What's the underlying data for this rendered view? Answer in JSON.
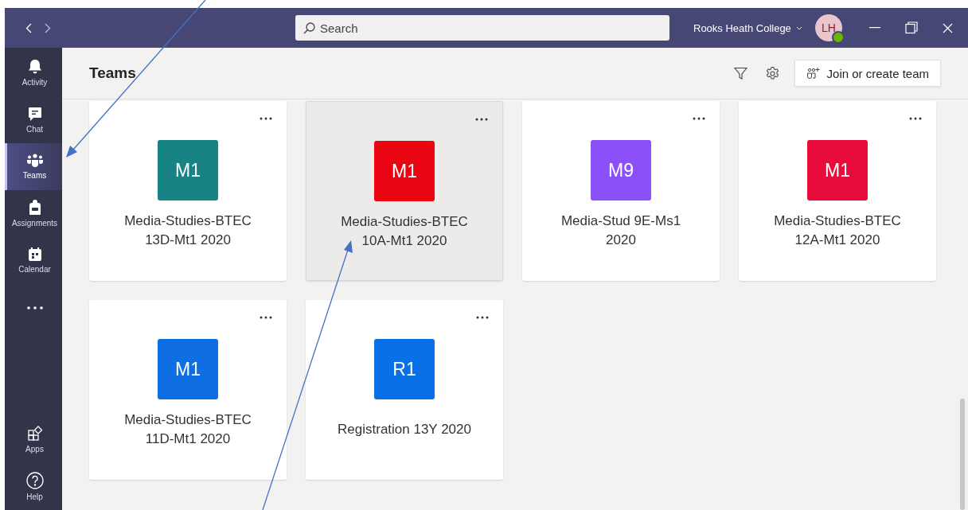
{
  "title_bar": {
    "search_placeholder": "Search",
    "organization": "Rooks Heath College",
    "avatar_initials": "LH",
    "presence_available": true
  },
  "rail": {
    "items": [
      {
        "kind": "activity",
        "label": "Activity",
        "selected": false
      },
      {
        "kind": "chat",
        "label": "Chat",
        "selected": false
      },
      {
        "kind": "teams",
        "label": "Teams",
        "selected": true
      },
      {
        "kind": "assignments",
        "label": "Assignments",
        "selected": false
      },
      {
        "kind": "calendar",
        "label": "Calendar",
        "selected": false
      },
      {
        "kind": "more",
        "selected": false
      }
    ],
    "bottom_items": [
      {
        "kind": "apps",
        "label": "Apps",
        "selected": false
      },
      {
        "kind": "help",
        "label": "Help",
        "selected": false
      }
    ]
  },
  "header": {
    "title": "Teams",
    "join_button": "Join or create team"
  },
  "teams": [
    {
      "initials": "M1",
      "name": "Media-Studies-BTEC\n13D-Mt1 2020",
      "color": "#178384",
      "highlighted": false
    },
    {
      "initials": "M1",
      "name": "Media-Studies-BTEC\n10A-Mt1 2020",
      "color": "#ea0512",
      "highlighted": true
    },
    {
      "initials": "M9",
      "name": "Media-Stud 9E-Ms1\n2020",
      "color": "#8b50fa",
      "highlighted": false
    },
    {
      "initials": "M1",
      "name": "Media-Studies-BTEC\n12A-Mt1 2020",
      "color": "#e70c3c",
      "highlighted": false
    },
    {
      "initials": "M1",
      "name": "Media-Studies-BTEC\n11D-Mt1 2020",
      "color": "#0f6ee3",
      "highlighted": false
    },
    {
      "initials": "R1",
      "name": "Registration 13Y 2020",
      "color": "#0a70e8",
      "highlighted": false
    }
  ]
}
